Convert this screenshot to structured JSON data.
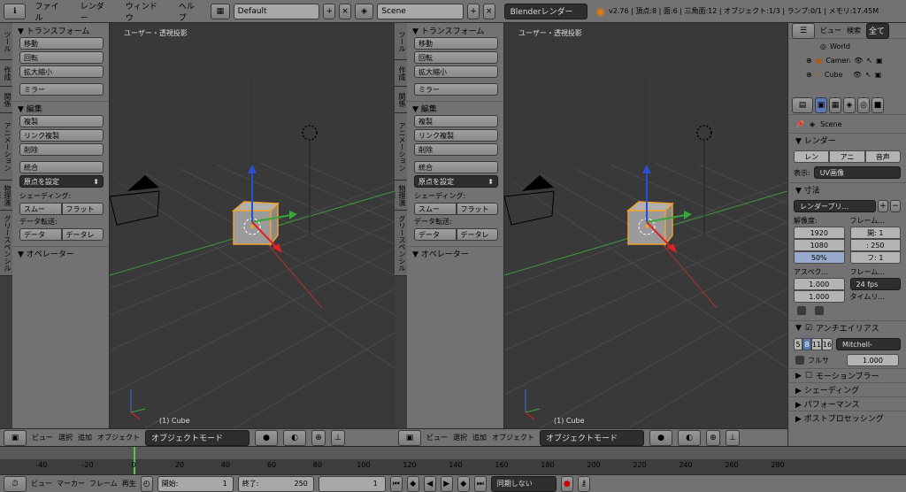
{
  "topbar": {
    "menus": [
      "ファイル",
      "レンダー",
      "ウィンドウ",
      "ヘルプ"
    ],
    "layout": "Default",
    "scene": "Scene",
    "engine": "Blenderレンダー",
    "stats": "v2.76 | 頂点:8 | 面:6 | 三角面:12 | オブジェクト:1/3 | ランプ:0/1 | メモリ:17.45M"
  },
  "side_tabs": [
    "ツール",
    "作成",
    "関係",
    "アニメーション",
    "物理演算",
    "グリースペンシル"
  ],
  "toolshelf": {
    "transform_header": "▼ トランスフォーム",
    "transform_buttons": [
      "移動",
      "回転",
      "拡大縮小"
    ],
    "mirror": "ミラー",
    "edit_header": "▼ 編集",
    "edit_buttons": [
      "複製",
      "リンク複製",
      "削除"
    ],
    "join": "統合",
    "origin": "原点を設定",
    "shading_label": "シェーディング:",
    "smooth": "スムー",
    "flat": "フラット",
    "data_transfer_label": "データ転送:",
    "data": "データ",
    "data_layout": "データレ",
    "operator_header": "▼ オペレーター"
  },
  "viewport": {
    "title": "ユーザー・透視投影",
    "object_label": "(1) Cube"
  },
  "view3d_header": {
    "menus": [
      "ビュー",
      "選択",
      "追加",
      "オブジェクト"
    ],
    "mode": "オブジェクトモード"
  },
  "timeline": {
    "ticks": [
      "-40",
      "-20",
      "0",
      "20",
      "40",
      "60",
      "80",
      "100",
      "120",
      "140",
      "160",
      "180",
      "200",
      "220",
      "240",
      "260",
      "280"
    ],
    "menus": [
      "ビュー",
      "マーカー",
      "フレーム",
      "再生"
    ],
    "start_label": "開始:",
    "start": "1",
    "end_label": "終了:",
    "end": "250",
    "current": "1",
    "sync": "同期しない"
  },
  "outliner": {
    "tabs": [
      "ビュー",
      "検索"
    ],
    "all": "全て",
    "items": [
      "World",
      "Camera",
      "Cube"
    ]
  },
  "properties": {
    "scene": "Scene",
    "render_header": "▼ レンダー",
    "render_btns": [
      "レン",
      "アニ",
      "音声"
    ],
    "display_label": "表示:",
    "display_value": "UV画像",
    "dimensions_header": "▼ 寸法",
    "preset": "レンダープリ...",
    "resolution_label": "解像度:",
    "res_x": "1920",
    "res_y": "1080",
    "res_pct": "50%",
    "frame_label": "フレーム...",
    "frame_start": "開: 1",
    "frame_end": ": 250",
    "frame_step": "フ: 1",
    "aspect_label": "アスペク...",
    "aspect_x": "1.000",
    "aspect_y": "1.000",
    "framerate_label": "フレーム...",
    "fps": "24 fps",
    "time_label": "タイムリ...",
    "aa_header": "アンチエイリアス",
    "aa_samples": [
      "5",
      "8",
      "11",
      "16"
    ],
    "aa_filter": "Mitchell-",
    "full_sample": "フルサ",
    "aa_size": "1.000",
    "motion_blur": "モーションブラー",
    "shading_header": "▶ シェーディング",
    "performance_header": "▶ パフォーマンス",
    "postprocessing_header": "▶ ポストプロセッシング"
  }
}
